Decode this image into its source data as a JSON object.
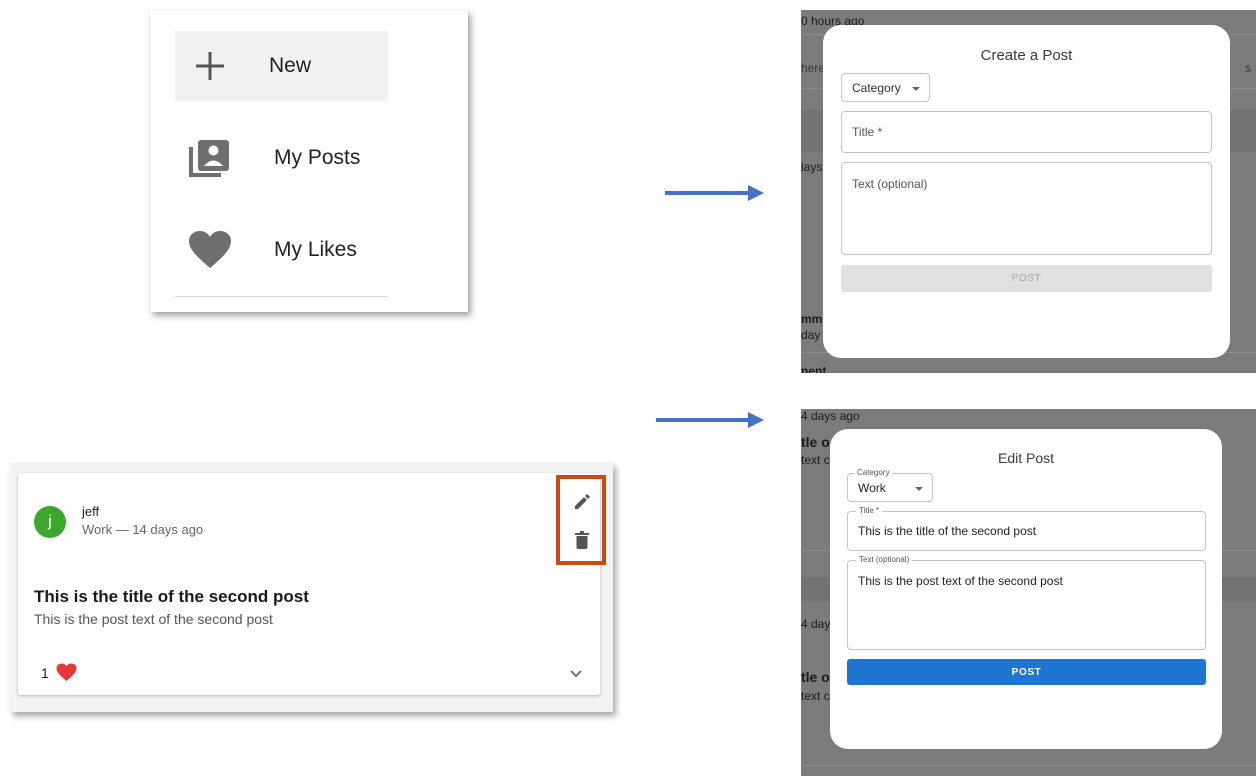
{
  "nav_menu": {
    "items": [
      {
        "label": "New",
        "icon": "plus-icon"
      },
      {
        "label": "My Posts",
        "icon": "my-posts-icon"
      },
      {
        "label": "My Likes",
        "icon": "heart-icon"
      }
    ]
  },
  "post_card": {
    "avatar_letter": "j",
    "author": "jeff",
    "meta": "Work — 14 days ago",
    "title": "This is the title of the second post",
    "text": "This is the post text of the second post",
    "likes": "1",
    "highlight_color": "#c94a12"
  },
  "create_modal": {
    "background": {
      "time": "0 hours ago",
      "search_left": "here",
      "search_right": "s",
      "days": "lays",
      "comment_top": "mm",
      "comment_days": "day",
      "bottom": "nent"
    },
    "title": "Create a Post",
    "category_label": "Category",
    "title_placeholder": "Title *",
    "text_placeholder": "Text (optional)",
    "post_button": "POST"
  },
  "edit_modal": {
    "background": {
      "time": "4 days ago",
      "title_frag": "tle o",
      "text_frag": "text c",
      "days": "4 day",
      "title_frag2": "tle o",
      "text_frag2": "text c"
    },
    "title": "Edit Post",
    "category_label": "Category",
    "category_value": "Work",
    "title_label": "Title *",
    "title_value": "This is the title of the second post",
    "text_label": "Text (optional)",
    "text_value": "This is the post text of the second post",
    "post_button": "POST",
    "accent_color": "#1e76d2"
  }
}
